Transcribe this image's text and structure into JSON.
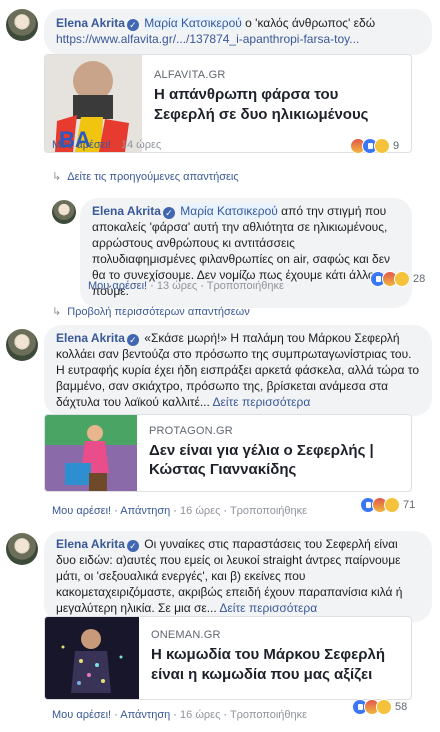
{
  "comments": [
    {
      "author": "Elena Akrita",
      "mention": "Μαρία Κατσικερού",
      "text": " ο 'καλός άνθρωπος' εδώ",
      "link": "https://www.alfavita.gr/.../137874_i-apanthropi-farsa-toy...",
      "card": {
        "domain": "ALFAVITA.GR",
        "title": "Η απάνθρωπη φάρσα του Σεφερλή σε δυο ηλικιωμένους"
      },
      "like_label": "Μου αρέσει!",
      "reply_label": "",
      "time": "14 ώρες",
      "edited": "",
      "reactions": [
        "angry-icon",
        "like-icon",
        "sad-icon"
      ],
      "reaction_count": "9"
    },
    {
      "author": "Elena Akrita",
      "text": "«Σκάσε μωρή!» Η παλάμη του Μάρκου Σεφερλή κολλάει σαν βεντούζα στο πρόσωπο της συμπρωταγωνίστριας του. Η ευτραφής κυρία έχει ήδη εισπράξει αρκετά φάσκελα, αλλά τώρα το βαμμένο, σαν σκιάχτρο, πρόσωπο της, βρίσκεται ανάμεσα στα δάχτυλα του λαϊκού καλλιτέ...",
      "see_more": "Δείτε περισσότερα",
      "card": {
        "domain": "PROTAGON.GR",
        "title": "Δεν είναι για γέλια ο Σεφερλής | Κώστας Γιαννακίδης"
      },
      "like_label": "Μου αρέσει!",
      "reply_label": "Απάντηση",
      "time": "16 ώρες",
      "edited": "Τροποποιήθηκε",
      "reactions": [
        "like-icon",
        "angry-icon",
        "sad-icon"
      ],
      "reaction_count": "71"
    },
    {
      "author": "Elena Akrita",
      "text": "Οι γυναίκες στις παραστάσεις του Σεφερλή είναι δυο ειδών: α)αυτές που εμείς οι λευκοί straight άντρες παίρνουμε μάτι, οι 'σεξουαλικά ενεργές', και β) εκείνες που κακομεταχειριζόμαστε, ακριβώς επειδή έχουν παραπανίσια κιλά ή μεγαλύτερη ηλικία. Σε μια σε...",
      "see_more": "Δείτε περισσότερα",
      "card": {
        "domain": "ONEMAN.GR",
        "title": "Η κωμωδία του Μάρκου Σεφερλή είναι η κωμωδία που μας αξίζει"
      },
      "like_label": "Μου αρέσει!",
      "reply_label": "Απάντηση",
      "time": "16 ώρες",
      "edited": "Τροποποιήθηκε",
      "reactions": [
        "like-icon",
        "angry-icon",
        "sad-icon"
      ],
      "reaction_count": "58"
    }
  ],
  "prev_replies": "Δείτε τις προηγούμενες απαντήσεις",
  "reply": {
    "author": "Elena Akrita",
    "mention": "Μαρία Κατσικερού",
    "text": " από την στιγμή που αποκαλείς 'φάρσα' αυτή την αθλιότητα σε ηλικιωμένους, αρρώστους ανθρώπους κι αντιτάσσεις πολυδιαφημισμένες φιλανθρωπίες on air, σαφώς και δεν θα το συνεχίσουμε. Δεν νομίζω πως έχουμε κάτι άλλο να πούμε.",
    "like_label": "Μου αρέσει!",
    "reply_label": "",
    "time": "13 ώρες",
    "edited": "Τροποποιήθηκε",
    "reactions": [
      "like-icon",
      "angry-icon",
      "haha-icon"
    ],
    "reaction_count": "28"
  },
  "more_replies": "Προβολή περισσότερων απαντήσεων",
  "colors": {
    "link": "#385898",
    "bubble": "#f2f3f5",
    "like_blue": "#3b76f3"
  }
}
